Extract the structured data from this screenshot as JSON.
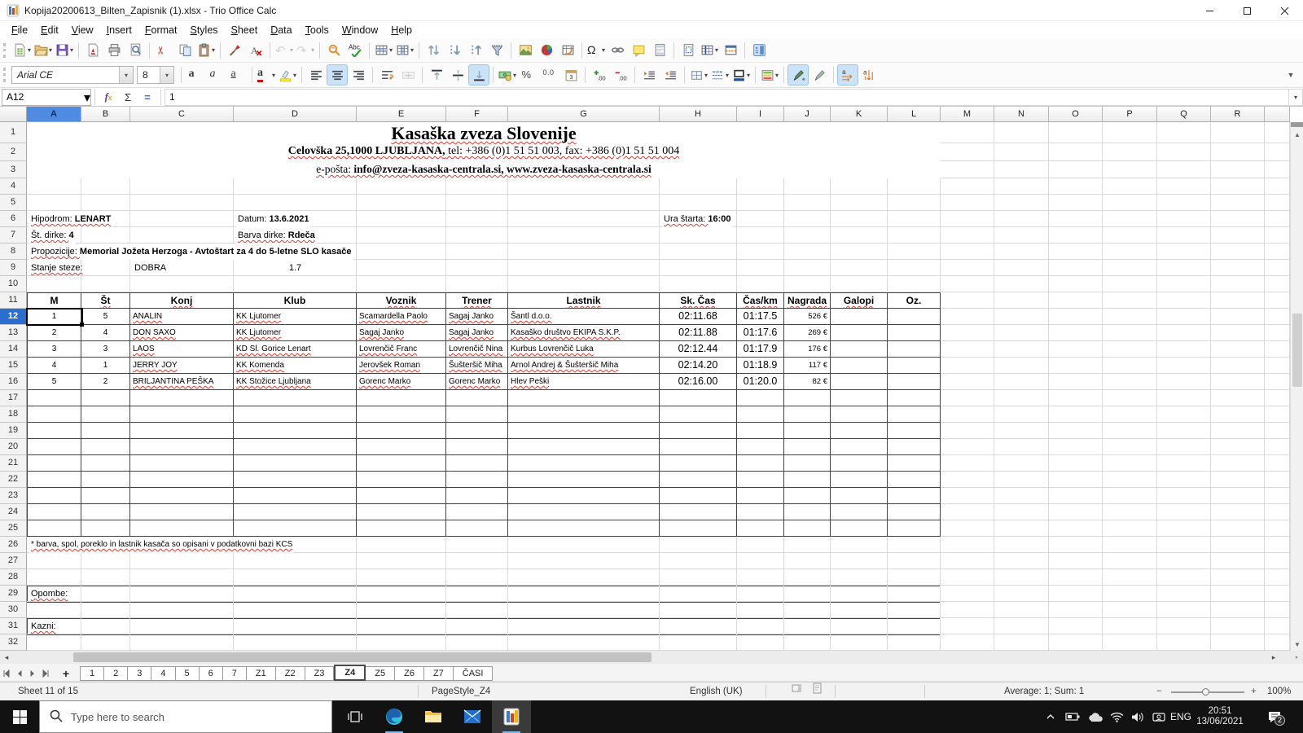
{
  "window": {
    "title": "Kopija20200613_Bilten_Zapisnik (1).xlsx - Trio Office Calc"
  },
  "menu": [
    "File",
    "Edit",
    "View",
    "Insert",
    "Format",
    "Styles",
    "Sheet",
    "Data",
    "Tools",
    "Window",
    "Help"
  ],
  "toolbars": {
    "standard": [
      "new|dd",
      "open|dd",
      "save|dd",
      "|",
      "export-pdf",
      "print",
      "print-preview",
      "|",
      "cut",
      "copy",
      "paste|dd",
      "|",
      "clone-formatting",
      "clear-formatting",
      "|",
      "undo|dd|dis",
      "redo|dd|dis",
      "|",
      "find-replace",
      "spelling",
      "|",
      "insert-rows|dd",
      "insert-columns|dd",
      "|",
      "sort",
      "sort-ascending",
      "sort-descending",
      "autofilter",
      "|",
      "insert-image",
      "insert-chart",
      "pivot-table",
      "|",
      "special-character|dd",
      "hyperlink",
      "insert-comment",
      "headers-footers",
      "|",
      "print-area",
      "freeze-panes|dd",
      "split-window",
      "|",
      "sidebar"
    ],
    "formatting": {
      "font_name": "Arial CE",
      "font_size": "8",
      "buttons": [
        "bold",
        "italic",
        "underline",
        "|",
        "font-color|dd",
        "highlight-color|dd",
        "|",
        "align-left",
        "align-center|on",
        "align-right",
        "|",
        "wrap-text",
        "merge-cells|dis",
        "|",
        "align-top",
        "center-vertically",
        "align-bottom|on",
        "|",
        "currency|dd",
        "percent",
        "number",
        "date",
        "|",
        "add-decimal",
        "delete-decimal",
        "|",
        "increase-indent",
        "decrease-indent",
        "|",
        "borders|dd",
        "border-style|dd",
        "border-color|dd",
        "|",
        "conditional-formatting|dd",
        "|",
        "highlighting-pen|on",
        "highlighting-pen-off",
        "|",
        "text-direction-ltr|on",
        "text-direction-ttb"
      ]
    }
  },
  "formula_bar": {
    "cell_reference": "A12",
    "formula": "1"
  },
  "grid": {
    "columns": [
      "A",
      "B",
      "C",
      "D",
      "E",
      "F",
      "G",
      "H",
      "I",
      "J",
      "K",
      "L",
      "M",
      "N",
      "O",
      "P",
      "Q",
      "R"
    ],
    "row_numbers": [
      1,
      2,
      3,
      4,
      5,
      6,
      7,
      8,
      9,
      10,
      11,
      12,
      13,
      14,
      15,
      16,
      17,
      18,
      19,
      20,
      21,
      22,
      23,
      24,
      25,
      26,
      27,
      28,
      29,
      30,
      31,
      32
    ],
    "selected_column": "A",
    "selected_row": 12,
    "doc_header": {
      "title": "Kasaška zveza Slovenije",
      "address_bold": "Celovška 25,1000 LJUBLJANA,",
      "address_rest": " tel: +386 (0)1 51 51 003, fax: +386 (0)1 51 51 004",
      "eposta_label": "e-pošta: ",
      "eposta_bold": "info@zveza-kasaska-centrala.si, www.zveza-kasaska-centrala.si"
    },
    "info": {
      "hipodrom_label": "Hipodrom: ",
      "hipodrom": "LENART",
      "datum_label": "Datum: ",
      "datum": "13.6.2021",
      "ura_label": "Ura štarta: ",
      "ura": "16:00",
      "st_dirke_label": "Št. dirke: ",
      "st_dirke": "4",
      "barva_label": "Barva dirke: ",
      "barva": "Rdeča",
      "propozicije_label": "Propozicije: ",
      "propozicije": "Memorial Jožeta Herzoga - Avtoštart za 4 do 5-letne SLO kasače",
      "stanje_label": "Stanje steze:",
      "stanje": "DOBRA",
      "stanje_koef": "1.7"
    },
    "table": {
      "headers": [
        "M",
        "Št",
        "Konj",
        "Klub",
        "Voznik",
        "Trener",
        "Lastnik",
        "Sk. Čas",
        "Čas/km",
        "Nagrada",
        "Galopi",
        "Oz."
      ],
      "rows": [
        [
          "1",
          "5",
          "ANALIN",
          "KK Ljutomer",
          "Scamardella Paolo",
          "Sagaj Janko",
          "Šantl d.o.o.",
          "02:11.68",
          "01:17.5",
          "526 €",
          "",
          ""
        ],
        [
          "2",
          "4",
          "DON SAXO",
          "KK Ljutomer",
          "Sagaj Janko",
          "Sagaj Janko",
          "Kasaško društvo EKIPA S.K.P.",
          "02:11.88",
          "01:17.6",
          "269 €",
          "",
          ""
        ],
        [
          "3",
          "3",
          "LAOS",
          "KD Sl. Gorice Lenart",
          "Lovrenčič Franc",
          "Lovrenčič Nina",
          "Kurbus Lovrenčič Luka",
          "02:12.44",
          "01:17.9",
          "176 €",
          "",
          ""
        ],
        [
          "4",
          "1",
          "JERRY JOY",
          "KK Komenda",
          "Jerovšek Roman",
          "Šušteršič Miha",
          "Arnol Andrej & Šušteršič Miha",
          "02:14.20",
          "01:18.9",
          "117 €",
          "",
          ""
        ],
        [
          "5",
          "2",
          "BRILJANTINA PEŠKA",
          "KK Stožice Ljubljana",
          "Gorenc Marko",
          "Gorenc Marko",
          "Hlev Peški",
          "02:16.00",
          "01:20.0",
          "82 €",
          "",
          ""
        ]
      ]
    },
    "footnote": "* barva, spol, poreklo in lastnik kasača so opisani v podatkovni bazi KCS",
    "opombe_label": "Opombe:",
    "kazni_label": "Kazni:"
  },
  "sheet_bar": {
    "tabs": [
      "1",
      "2",
      "3",
      "4",
      "5",
      "6",
      "7",
      "Z1",
      "Z2",
      "Z3",
      "Z4",
      "Z5",
      "Z6",
      "Z7",
      "ČASI"
    ],
    "active_tab": "Z4"
  },
  "status_bar": {
    "sheet_info": "Sheet 11 of 15",
    "page_style": "PageStyle_Z4",
    "language": "English (UK)",
    "average_sum": "Average: 1; Sum: 1",
    "zoom_level": "100%"
  },
  "taskbar": {
    "search_placeholder": "Type here to search",
    "language_indicator": "ENG",
    "time": "20:51",
    "date": "13/06/2021",
    "notification_count": "2"
  },
  "colors": {
    "selection_blue": "#2a6fd0",
    "table_border": "#454545",
    "accent_underline": "#76b9ed",
    "taskbar_bg": "#121212"
  }
}
